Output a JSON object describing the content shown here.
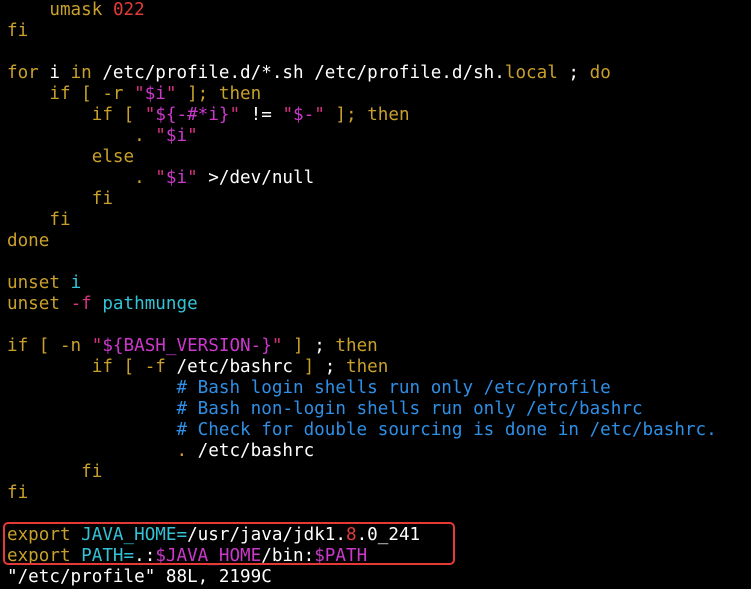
{
  "colors": {
    "text": "#ffffff",
    "keyword": "#c8a02a",
    "string": "#d6317f",
    "special": "#cc38cc",
    "comment": "#2f8fe6",
    "variable": "#33c3d6",
    "number": "#e23b3b",
    "highlight_border": "#e53935",
    "background": "#000000"
  },
  "editor": {
    "file_info": "\"/etc/profile\" 88L, 2199C",
    "lines": [
      [
        {
          "t": "    ",
          "c": "text"
        },
        {
          "t": "umask",
          "c": "keyword"
        },
        {
          "t": " ",
          "c": "text"
        },
        {
          "t": "022",
          "c": "number"
        }
      ],
      [
        {
          "t": "fi",
          "c": "keyword"
        }
      ],
      [],
      [
        {
          "t": "for",
          "c": "keyword"
        },
        {
          "t": " i ",
          "c": "text"
        },
        {
          "t": "in",
          "c": "keyword"
        },
        {
          "t": " /etc/profile.d/*.sh /etc/profile.d/sh.",
          "c": "text"
        },
        {
          "t": "local",
          "c": "keyword"
        },
        {
          "t": " ; ",
          "c": "text"
        },
        {
          "t": "do",
          "c": "keyword"
        }
      ],
      [
        {
          "t": "    ",
          "c": "text"
        },
        {
          "t": "if",
          "c": "keyword"
        },
        {
          "t": " ",
          "c": "text"
        },
        {
          "t": "[",
          "c": "keyword"
        },
        {
          "t": " ",
          "c": "text"
        },
        {
          "t": "-r",
          "c": "keyword"
        },
        {
          "t": " ",
          "c": "text"
        },
        {
          "t": "\"",
          "c": "string"
        },
        {
          "t": "$i",
          "c": "special"
        },
        {
          "t": "\"",
          "c": "string"
        },
        {
          "t": " ",
          "c": "text"
        },
        {
          "t": "];",
          "c": "keyword"
        },
        {
          "t": " ",
          "c": "text"
        },
        {
          "t": "then",
          "c": "keyword"
        }
      ],
      [
        {
          "t": "        ",
          "c": "text"
        },
        {
          "t": "if",
          "c": "keyword"
        },
        {
          "t": " ",
          "c": "text"
        },
        {
          "t": "[",
          "c": "keyword"
        },
        {
          "t": " ",
          "c": "text"
        },
        {
          "t": "\"",
          "c": "string"
        },
        {
          "t": "${-#*i}",
          "c": "special"
        },
        {
          "t": "\"",
          "c": "string"
        },
        {
          "t": " != ",
          "c": "text"
        },
        {
          "t": "\"",
          "c": "string"
        },
        {
          "t": "$-",
          "c": "special"
        },
        {
          "t": "\"",
          "c": "string"
        },
        {
          "t": " ",
          "c": "text"
        },
        {
          "t": "];",
          "c": "keyword"
        },
        {
          "t": " ",
          "c": "text"
        },
        {
          "t": "then",
          "c": "keyword"
        }
      ],
      [
        {
          "t": "            ",
          "c": "text"
        },
        {
          "t": ".",
          "c": "keyword"
        },
        {
          "t": " ",
          "c": "text"
        },
        {
          "t": "\"",
          "c": "string"
        },
        {
          "t": "$i",
          "c": "special"
        },
        {
          "t": "\"",
          "c": "string"
        }
      ],
      [
        {
          "t": "        ",
          "c": "text"
        },
        {
          "t": "else",
          "c": "keyword"
        }
      ],
      [
        {
          "t": "            ",
          "c": "text"
        },
        {
          "t": ".",
          "c": "keyword"
        },
        {
          "t": " ",
          "c": "text"
        },
        {
          "t": "\"",
          "c": "string"
        },
        {
          "t": "$i",
          "c": "special"
        },
        {
          "t": "\"",
          "c": "string"
        },
        {
          "t": " >/dev/null",
          "c": "text"
        }
      ],
      [
        {
          "t": "        ",
          "c": "text"
        },
        {
          "t": "fi",
          "c": "keyword"
        }
      ],
      [
        {
          "t": "    ",
          "c": "text"
        },
        {
          "t": "fi",
          "c": "keyword"
        }
      ],
      [
        {
          "t": "done",
          "c": "keyword"
        }
      ],
      [],
      [
        {
          "t": "unset",
          "c": "keyword"
        },
        {
          "t": " ",
          "c": "text"
        },
        {
          "t": "i",
          "c": "variable"
        }
      ],
      [
        {
          "t": "unset",
          "c": "keyword"
        },
        {
          "t": " ",
          "c": "text"
        },
        {
          "t": "-f",
          "c": "string"
        },
        {
          "t": " ",
          "c": "text"
        },
        {
          "t": "pathmunge",
          "c": "variable"
        }
      ],
      [],
      [
        {
          "t": "if",
          "c": "keyword"
        },
        {
          "t": " ",
          "c": "text"
        },
        {
          "t": "[",
          "c": "keyword"
        },
        {
          "t": " ",
          "c": "text"
        },
        {
          "t": "-n",
          "c": "keyword"
        },
        {
          "t": " ",
          "c": "text"
        },
        {
          "t": "\"",
          "c": "string"
        },
        {
          "t": "${BASH_VERSION-}",
          "c": "special"
        },
        {
          "t": "\"",
          "c": "string"
        },
        {
          "t": " ",
          "c": "text"
        },
        {
          "t": "]",
          "c": "keyword"
        },
        {
          "t": " ; ",
          "c": "text"
        },
        {
          "t": "then",
          "c": "keyword"
        }
      ],
      [
        {
          "t": "        ",
          "c": "text"
        },
        {
          "t": "if",
          "c": "keyword"
        },
        {
          "t": " ",
          "c": "text"
        },
        {
          "t": "[",
          "c": "keyword"
        },
        {
          "t": " ",
          "c": "text"
        },
        {
          "t": "-f",
          "c": "keyword"
        },
        {
          "t": " /etc/bashrc ",
          "c": "text"
        },
        {
          "t": "]",
          "c": "keyword"
        },
        {
          "t": " ; ",
          "c": "text"
        },
        {
          "t": "then",
          "c": "keyword"
        }
      ],
      [
        {
          "t": "                ",
          "c": "text"
        },
        {
          "t": "# Bash login shells run only /etc/profile",
          "c": "comment"
        }
      ],
      [
        {
          "t": "                ",
          "c": "text"
        },
        {
          "t": "# Bash non-login shells run only /etc/bashrc",
          "c": "comment"
        }
      ],
      [
        {
          "t": "                ",
          "c": "text"
        },
        {
          "t": "# Check for double sourcing is done in /etc/bashrc.",
          "c": "comment"
        }
      ],
      [
        {
          "t": "                ",
          "c": "text"
        },
        {
          "t": ".",
          "c": "keyword"
        },
        {
          "t": " /etc/bashrc",
          "c": "text"
        }
      ],
      [
        {
          "t": "       ",
          "c": "text"
        },
        {
          "t": "fi",
          "c": "keyword"
        }
      ],
      [
        {
          "t": "fi",
          "c": "keyword"
        }
      ],
      [],
      [
        {
          "t": "export",
          "c": "keyword"
        },
        {
          "t": " ",
          "c": "text"
        },
        {
          "t": "JAVA_HOME=",
          "c": "variable"
        },
        {
          "t": "/usr/java/jdk1.",
          "c": "text"
        },
        {
          "t": "8",
          "c": "number"
        },
        {
          "t": ".0_241",
          "c": "text"
        }
      ],
      [
        {
          "t": "export",
          "c": "keyword"
        },
        {
          "t": " ",
          "c": "text"
        },
        {
          "t": "PATH=",
          "c": "variable"
        },
        {
          "t": ".:",
          "c": "text"
        },
        {
          "t": "$JAVA_HOME",
          "c": "special"
        },
        {
          "t": "/bin:",
          "c": "text"
        },
        {
          "t": "$PATH",
          "c": "special"
        }
      ]
    ]
  }
}
